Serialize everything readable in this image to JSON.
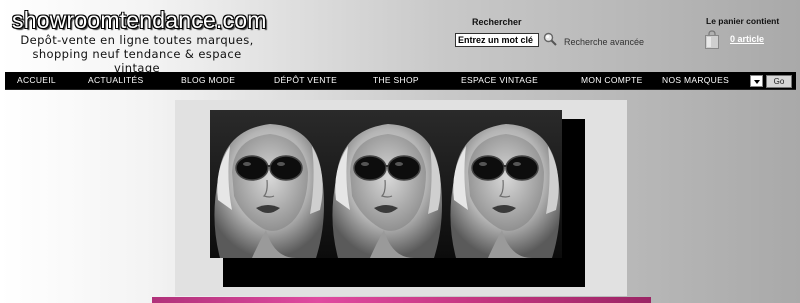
{
  "header": {
    "logo": "showroomtendance.com",
    "tagline": "Depôt-vente en ligne toutes marques, shopping neuf tendance & espace vintage"
  },
  "search": {
    "label": "Rechercher",
    "value": "Entrez un mot clé",
    "advanced_link": "Recherche avancée"
  },
  "cart": {
    "label": "Le panier contient",
    "count_link": "0 article"
  },
  "nav": {
    "items": [
      {
        "label": "ACCUEIL"
      },
      {
        "label": "ACTUALITÉS"
      },
      {
        "label": "BLOG MODE"
      },
      {
        "label": "DÉPÔT VENTE"
      },
      {
        "label": "THE SHOP"
      },
      {
        "label": "ESPACE VINTAGE"
      },
      {
        "label": "MON COMPTE"
      },
      {
        "label": "NOS MARQUES"
      }
    ],
    "go_label": "Go"
  },
  "banner": {
    "image": "triple portrait of a woman in sunglasses, black and white"
  },
  "colors": {
    "navbar": "#000000",
    "banner_frame": "#e1e1e1",
    "accent_pink": "#e04aa0"
  }
}
